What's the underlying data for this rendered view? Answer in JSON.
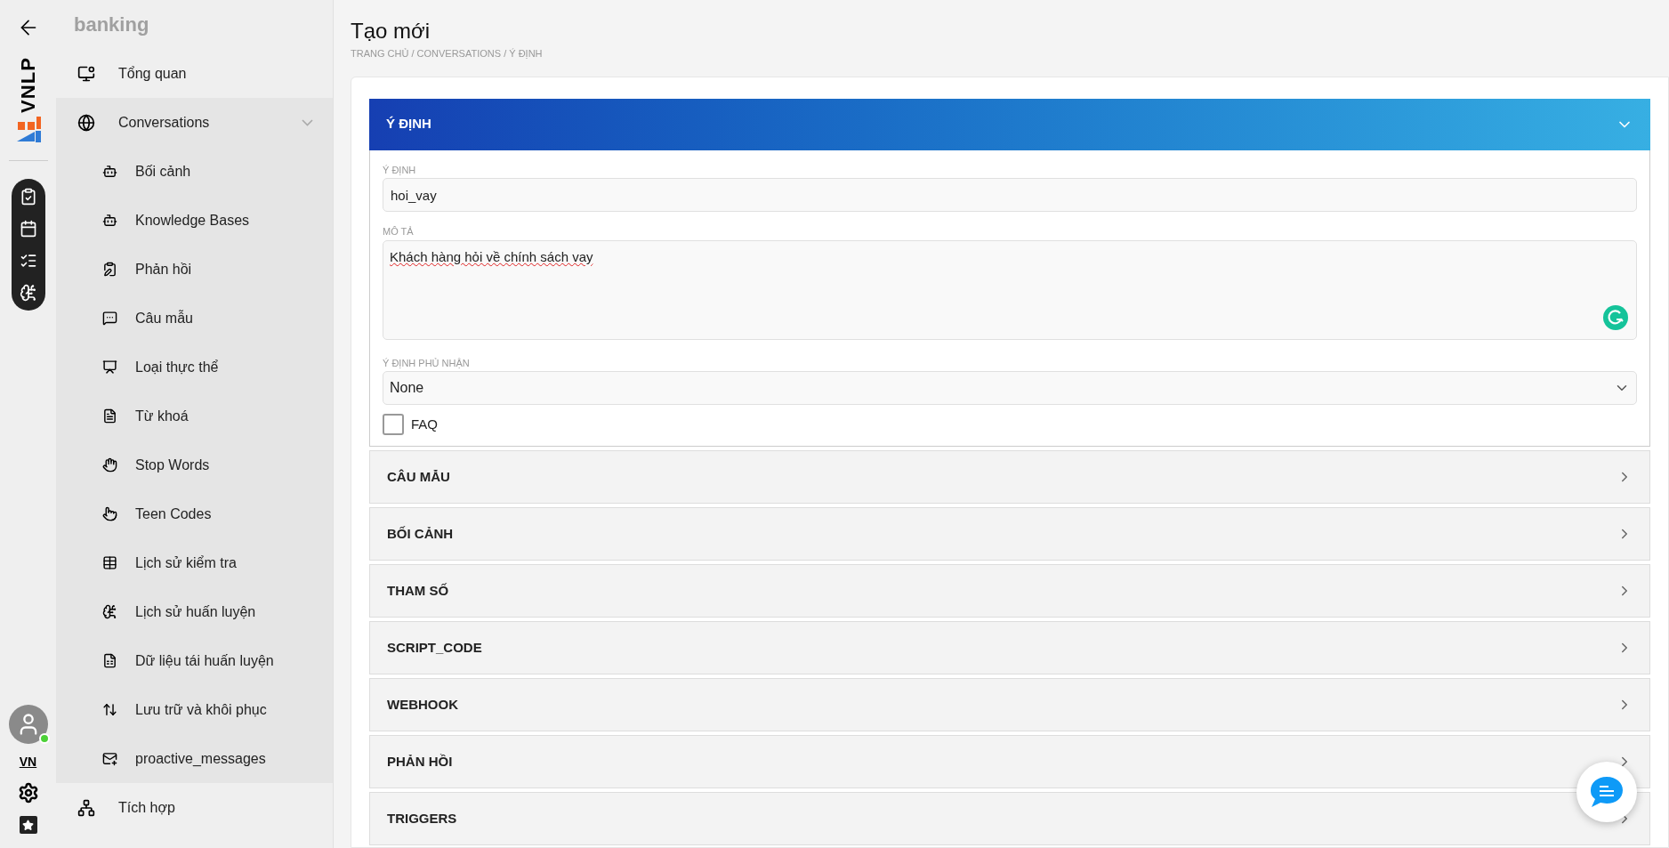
{
  "rail": {
    "logo_text": "VNLP",
    "user_online": true,
    "language": "VN"
  },
  "sidebar": {
    "project": "banking",
    "items": [
      {
        "label": "Tổng quan",
        "kind": "link"
      },
      {
        "label": "Conversations",
        "kind": "group",
        "expanded": true,
        "children": [
          {
            "label": "Bối cảnh"
          },
          {
            "label": "Knowledge Bases"
          },
          {
            "label": "Phản hồi"
          },
          {
            "label": "Câu mẫu"
          },
          {
            "label": "Loại thực thể"
          },
          {
            "label": "Từ khoá"
          },
          {
            "label": "Stop Words"
          },
          {
            "label": "Teen Codes"
          },
          {
            "label": "Lịch sử kiểm tra"
          },
          {
            "label": "Lịch sử huấn luyện"
          },
          {
            "label": "Dữ liệu tái huấn luyện"
          },
          {
            "label": "Lưu trữ và khôi phục"
          },
          {
            "label": "proactive_messages"
          }
        ]
      },
      {
        "label": "Tích hợp",
        "kind": "link"
      }
    ]
  },
  "page": {
    "title": "Tạo mới",
    "breadcrumb": "TRANG CHỦ / CONVERSATIONS / Ý ĐỊNH"
  },
  "sections": [
    {
      "title": "Ý ĐỊNH",
      "expanded": true,
      "form": {
        "intent": {
          "label": "Ý ĐỊNH",
          "value": "hoi_vay"
        },
        "description": {
          "label": "MÔ TẢ",
          "value": "Khách hàng hỏi về chính sách vay"
        },
        "negative_intent": {
          "label": "Ý ĐỊNH PHỦ NHẬN",
          "value": "None"
        },
        "faq": {
          "label": "FAQ",
          "checked": false
        }
      }
    },
    {
      "title": "CÂU MẪU",
      "expanded": false
    },
    {
      "title": "BỐI CẢNH",
      "expanded": false
    },
    {
      "title": "THAM SỐ",
      "expanded": false
    },
    {
      "title": "SCRIPT_CODE",
      "expanded": false
    },
    {
      "title": "WEBHOOK",
      "expanded": false
    },
    {
      "title": "PHẢN HỒI",
      "expanded": false
    },
    {
      "title": "TRIGGERS",
      "expanded": false
    }
  ]
}
